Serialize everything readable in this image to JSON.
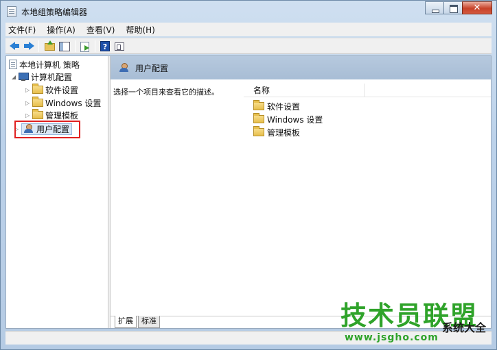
{
  "window": {
    "title": "本地组策略编辑器",
    "close_glyph": "✕"
  },
  "menu": [
    "文件(F)",
    "操作(A)",
    "查看(V)",
    "帮助(H)"
  ],
  "toolbar": {
    "icons": [
      "back-icon",
      "forward-icon",
      "up-folder-icon",
      "show-hide-tree-icon",
      "export-list-icon",
      "help-icon",
      "properties-icon"
    ],
    "help_glyph": "?"
  },
  "tree": {
    "root": "本地计算机 策略",
    "computer_config": "计算机配置",
    "children": [
      "软件设置",
      "Windows 设置",
      "管理模板"
    ],
    "user_config": "用户配置",
    "expanded_glyph": "◢",
    "collapsed_glyph": "▷"
  },
  "right_pane": {
    "header_title": "用户配置",
    "description": "选择一个项目来查看它的描述。",
    "column_name": "名称",
    "items": [
      "软件设置",
      "Windows 设置",
      "管理模板"
    ]
  },
  "tabs": [
    "扩展",
    "标准"
  ],
  "watermark": {
    "main": "技术员联盟",
    "side": "系统大全",
    "url": "www.jsgho.com"
  },
  "colors": {
    "highlight_red": "#e02020",
    "watermark_green": "#2fa32a",
    "header_blue": "#b6c9de"
  }
}
